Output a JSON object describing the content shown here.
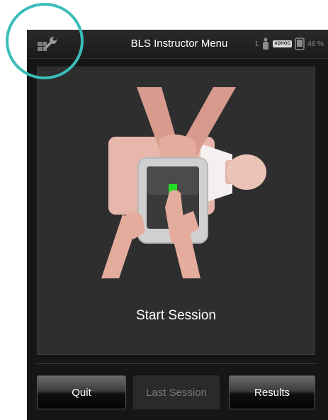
{
  "header": {
    "title": "BLS Instructor Menu",
    "tools_icon": "tools-wrench-icon",
    "status": {
      "count": "1",
      "manikin_icon": "manikin-icon",
      "connection_badge": "ADHOC",
      "device_icon": "tablet-icon",
      "battery": "46 %"
    }
  },
  "main": {
    "illustration_icon": "cpr-tablet-illustration",
    "action_label": "Start Session"
  },
  "footer": {
    "quit_label": "Quit",
    "last_session_label": "Last Session",
    "results_label": "Results"
  },
  "colors": {
    "highlight": "#3bbdb7",
    "accent_green": "#22dd22",
    "background": "#161616"
  }
}
